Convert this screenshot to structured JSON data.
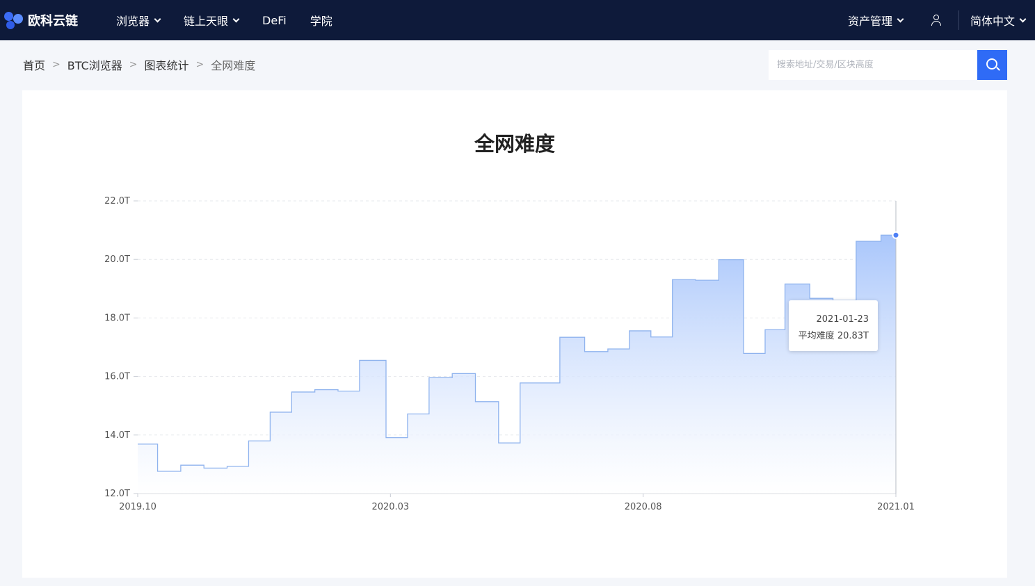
{
  "brand": {
    "name": "欧科云链"
  },
  "nav": {
    "items": [
      {
        "label": "浏览器",
        "dropdown": true
      },
      {
        "label": "链上天眼",
        "dropdown": true
      },
      {
        "label": "DeFi",
        "dropdown": false
      },
      {
        "label": "学院",
        "dropdown": false
      }
    ],
    "asset_label": "资产管理",
    "language_label": "简体中文"
  },
  "breadcrumb": [
    "首页",
    "BTC浏览器",
    "图表统计",
    "全网难度"
  ],
  "search": {
    "placeholder": "搜索地址/交易/区块高度",
    "value": ""
  },
  "colors": {
    "nav_bg": "#0e1a3a",
    "accent": "#2f6bf6",
    "line": "#8fb3ee",
    "fill_top": "#a9c6fb"
  },
  "chart_data": {
    "type": "area",
    "step": true,
    "title": "全网难度",
    "y_unit": "T",
    "ylim": [
      12.0,
      22.0
    ],
    "y_ticks": [
      "12.0T",
      "14.0T",
      "16.0T",
      "18.0T",
      "20.0T",
      "22.0T"
    ],
    "x_ticks": [
      "2019.10",
      "2020.03",
      "2020.08",
      "2021.01"
    ],
    "xlim": [
      "2019-10-01",
      "2021-01-01"
    ],
    "grid": true,
    "series": [
      {
        "points": [
          [
            "2019-10-01",
            13.69
          ],
          [
            "2019-10-13",
            12.76
          ],
          [
            "2019-10-27",
            12.97
          ],
          [
            "2019-11-10",
            12.87
          ],
          [
            "2019-11-24",
            12.93
          ],
          [
            "2019-12-07",
            13.8
          ],
          [
            "2019-12-20",
            14.78
          ],
          [
            "2020-01-02",
            15.47
          ],
          [
            "2020-01-16",
            15.55
          ],
          [
            "2020-01-30",
            15.5
          ],
          [
            "2020-02-12",
            16.55
          ],
          [
            "2020-02-28",
            13.91
          ],
          [
            "2020-03-12",
            14.72
          ],
          [
            "2020-03-25",
            15.96
          ],
          [
            "2020-04-08",
            16.1
          ],
          [
            "2020-04-22",
            15.14
          ],
          [
            "2020-05-06",
            13.73
          ],
          [
            "2020-05-19",
            15.78
          ],
          [
            "2020-06-12",
            17.34
          ],
          [
            "2020-06-27",
            16.85
          ],
          [
            "2020-07-11",
            16.94
          ],
          [
            "2020-07-24",
            17.56
          ],
          [
            "2020-08-06",
            17.35
          ],
          [
            "2020-08-19",
            19.31
          ],
          [
            "2020-09-02",
            19.29
          ],
          [
            "2020-09-16",
            19.99
          ],
          [
            "2020-10-01",
            16.79
          ],
          [
            "2020-10-14",
            17.6
          ],
          [
            "2020-10-26",
            19.16
          ],
          [
            "2020-11-10",
            18.67
          ],
          [
            "2020-11-24",
            18.6
          ],
          [
            "2020-12-08",
            20.62
          ],
          [
            "2020-12-23",
            20.83
          ],
          [
            "2021-01-01",
            20.83
          ]
        ]
      }
    ],
    "highlight": {
      "date": "2021-01-23",
      "label": "平均难度",
      "value": "20.83T"
    }
  }
}
